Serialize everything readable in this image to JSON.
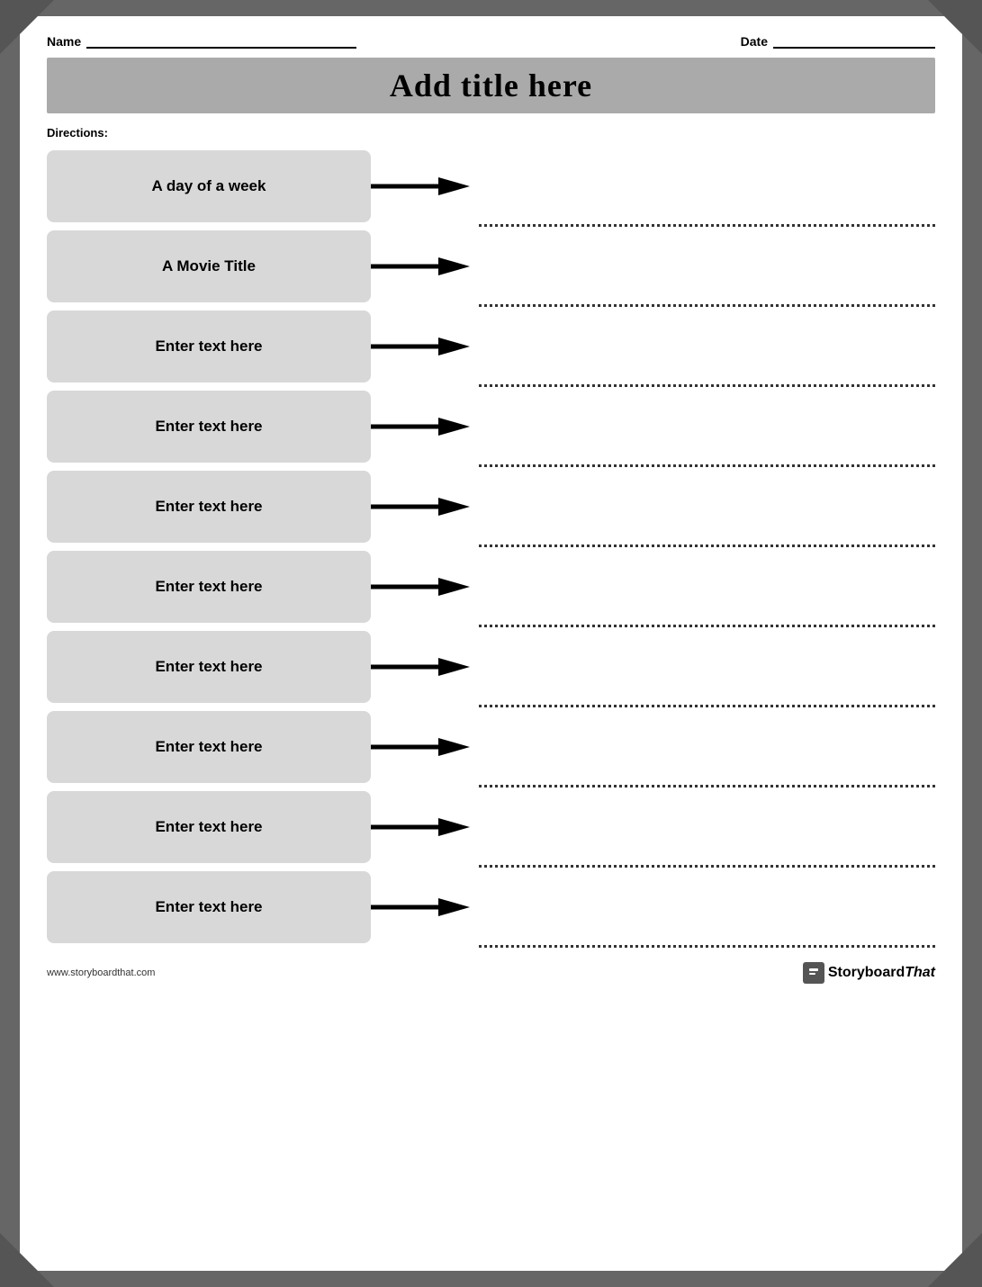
{
  "page": {
    "background_color": "#888",
    "sheet_background": "#fff"
  },
  "header": {
    "name_label": "Name",
    "date_label": "Date"
  },
  "title": {
    "text": "Add title here"
  },
  "directions": {
    "label": "Directions:"
  },
  "rows": [
    {
      "id": 1,
      "term": "A day of a week"
    },
    {
      "id": 2,
      "term": "A Movie Title"
    },
    {
      "id": 3,
      "term": "Enter text here"
    },
    {
      "id": 4,
      "term": "Enter text here"
    },
    {
      "id": 5,
      "term": "Enter text here"
    },
    {
      "id": 6,
      "term": "Enter text here"
    },
    {
      "id": 7,
      "term": "Enter text here"
    },
    {
      "id": 8,
      "term": "Enter text here"
    },
    {
      "id": 9,
      "term": "Enter text here"
    },
    {
      "id": 10,
      "term": "Enter text here"
    }
  ],
  "footer": {
    "url": "www.storyboardthat.com",
    "logo_text": "Storyboard",
    "logo_that": "That"
  }
}
